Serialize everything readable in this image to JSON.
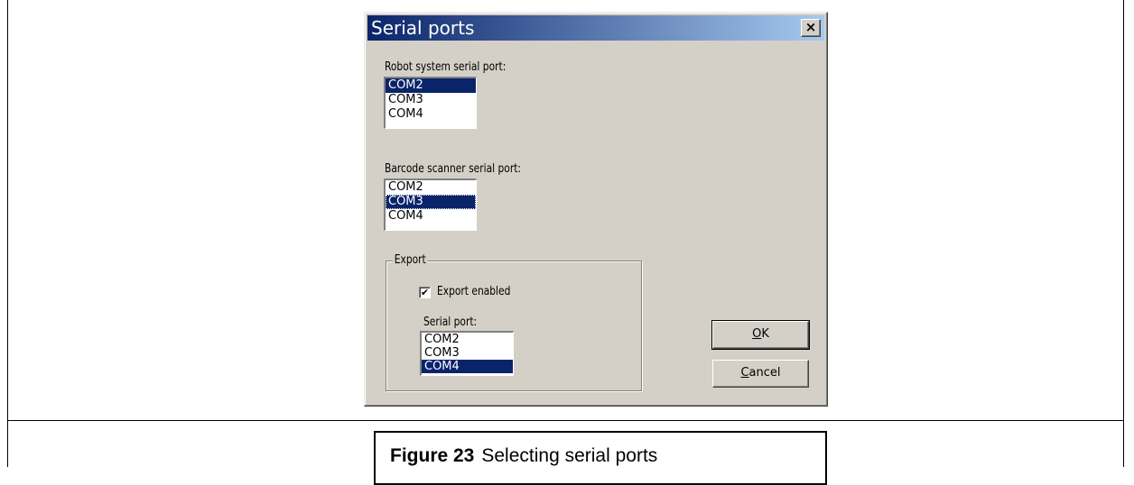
{
  "dialog": {
    "title": "Serial ports",
    "close_symbol": "×",
    "robot": {
      "label": "Robot system serial port:",
      "options": [
        "COM2",
        "COM3",
        "COM4"
      ],
      "selected": "COM2"
    },
    "barcode": {
      "label": "Barcode scanner serial port:",
      "options": [
        "COM2",
        "COM3",
        "COM4"
      ],
      "selected": "COM3"
    },
    "export": {
      "group_label": "Export",
      "checkbox_label": "Export enabled",
      "checked": true,
      "check_mark": "✔",
      "serial_label": "Serial port:",
      "options": [
        "COM2",
        "COM3",
        "COM4"
      ],
      "selected": "COM4"
    },
    "ok": {
      "accel": "O",
      "rest": "K"
    },
    "cancel": {
      "accel": "C",
      "rest": "ancel"
    }
  },
  "caption": {
    "number": "Figure 23",
    "text": "Selecting serial ports"
  }
}
